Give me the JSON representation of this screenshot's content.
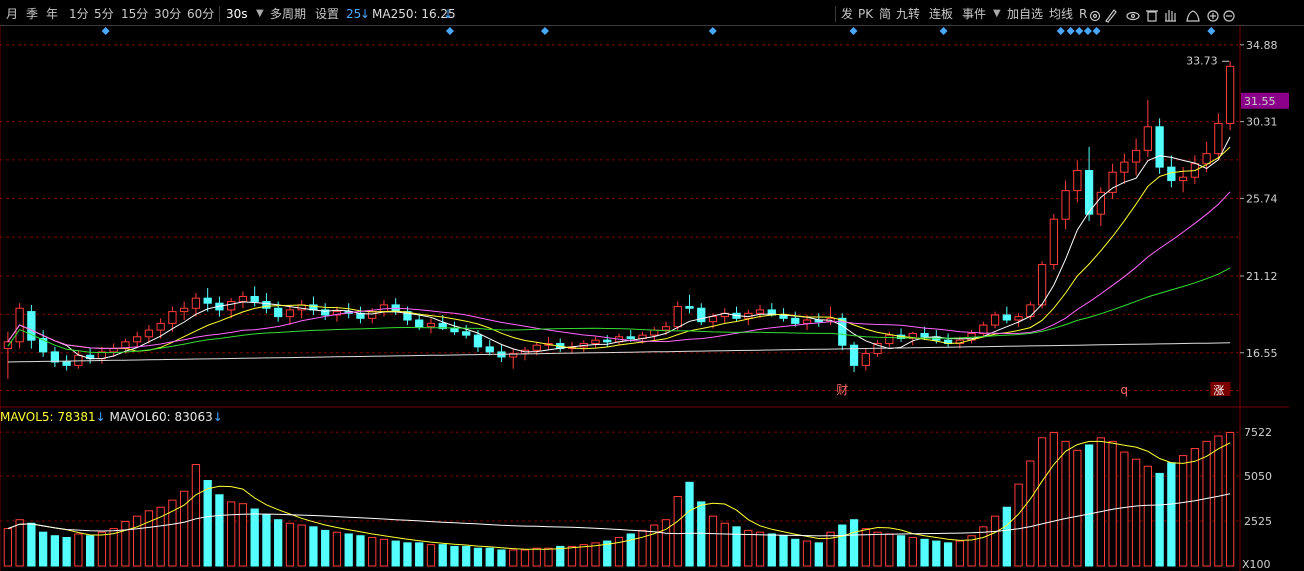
{
  "toolbar": {
    "periods": [
      "月",
      "季",
      "年",
      "1分",
      "5分",
      "15分",
      "30分",
      "60分"
    ],
    "interval": "30s",
    "multi_period": "多周期",
    "settings": "设置",
    "ma_count": "25",
    "ma250_label": "MA250: 16.25",
    "right_tools": [
      "发",
      "PK",
      "简",
      "九转",
      "连板",
      "事件"
    ],
    "add_watch": "加自选",
    "ma_lines": "均线",
    "r_mark": "R"
  },
  "price_axis": {
    "labels": [
      "34.88",
      "30.31",
      "25.74",
      "21.12",
      "16.55"
    ],
    "current_price": "31.55",
    "high_label": "33.73"
  },
  "volume_axis": {
    "labels": [
      "7522",
      "5050",
      "2525"
    ],
    "unit": "X100"
  },
  "volume_indicator": {
    "mavol5": "MAVOL5: 78381",
    "mavol60": "MAVOL60: 83063"
  },
  "markers": {
    "cai": "财",
    "q": "q",
    "zhang": "涨"
  },
  "colors": {
    "up": "#ff3c3c",
    "down": "#54ffff",
    "ma5": "#ffffff",
    "ma10": "#ffff33",
    "ma20": "#ff66ff",
    "ma60": "#33dd33",
    "ma250": "#dddddd",
    "grid": "#7a0000",
    "badge": "#8b008b"
  },
  "chart_data": {
    "type": "candlestick",
    "y_range": [
      13.5,
      36.0
    ],
    "volume_range": [
      0,
      8200
    ],
    "candles": [
      [
        16.8,
        17.8,
        15.0,
        17.2
      ],
      [
        17.2,
        19.5,
        16.8,
        19.2
      ],
      [
        19.0,
        19.4,
        16.8,
        17.3
      ],
      [
        17.4,
        17.9,
        16.3,
        16.6
      ],
      [
        16.6,
        16.9,
        15.7,
        16.0
      ],
      [
        16.0,
        16.4,
        15.5,
        15.8
      ],
      [
        15.8,
        16.7,
        15.6,
        16.4
      ],
      [
        16.4,
        16.8,
        15.9,
        16.2
      ],
      [
        16.2,
        16.9,
        15.9,
        16.6
      ],
      [
        16.6,
        17.1,
        16.3,
        16.8
      ],
      [
        16.8,
        17.4,
        16.5,
        17.2
      ],
      [
        17.2,
        17.8,
        16.9,
        17.5
      ],
      [
        17.5,
        18.2,
        17.1,
        17.9
      ],
      [
        17.9,
        18.6,
        17.4,
        18.3
      ],
      [
        18.3,
        19.3,
        17.8,
        19.0
      ],
      [
        19.0,
        19.6,
        18.5,
        19.2
      ],
      [
        19.2,
        20.1,
        18.7,
        19.8
      ],
      [
        19.8,
        20.4,
        19.0,
        19.5
      ],
      [
        19.5,
        19.9,
        18.7,
        19.1
      ],
      [
        19.1,
        19.8,
        18.6,
        19.6
      ],
      [
        19.6,
        20.2,
        19.2,
        19.9
      ],
      [
        19.9,
        20.5,
        19.3,
        19.6
      ],
      [
        19.6,
        20.1,
        18.9,
        19.2
      ],
      [
        19.2,
        19.6,
        18.4,
        18.7
      ],
      [
        18.7,
        19.4,
        18.2,
        19.1
      ],
      [
        19.1,
        19.7,
        18.6,
        19.4
      ],
      [
        19.4,
        19.9,
        18.8,
        19.1
      ],
      [
        19.1,
        19.5,
        18.5,
        18.8
      ],
      [
        18.8,
        19.3,
        18.4,
        19.0
      ],
      [
        19.0,
        19.5,
        18.6,
        18.9
      ],
      [
        18.9,
        19.3,
        18.3,
        18.6
      ],
      [
        18.6,
        19.2,
        18.3,
        19.0
      ],
      [
        19.0,
        19.7,
        18.7,
        19.4
      ],
      [
        19.4,
        19.8,
        18.8,
        19.0
      ],
      [
        19.0,
        19.3,
        18.2,
        18.5
      ],
      [
        18.5,
        18.9,
        17.9,
        18.1
      ],
      [
        18.1,
        18.6,
        17.7,
        18.3
      ],
      [
        18.3,
        18.8,
        17.9,
        18.0
      ],
      [
        18.0,
        18.4,
        17.6,
        17.8
      ],
      [
        17.8,
        18.2,
        17.4,
        17.6
      ],
      [
        17.6,
        17.9,
        16.6,
        16.9
      ],
      [
        16.9,
        17.3,
        16.4,
        16.6
      ],
      [
        16.6,
        17.0,
        16.0,
        16.3
      ],
      [
        16.3,
        16.8,
        15.6,
        16.5
      ],
      [
        16.5,
        16.9,
        16.1,
        16.7
      ],
      [
        16.7,
        17.2,
        16.4,
        17.0
      ],
      [
        17.0,
        17.5,
        16.7,
        17.1
      ],
      [
        17.1,
        17.4,
        16.6,
        16.8
      ],
      [
        16.8,
        17.2,
        16.5,
        16.9
      ],
      [
        16.9,
        17.3,
        16.6,
        17.1
      ],
      [
        17.1,
        17.5,
        16.8,
        17.3
      ],
      [
        17.3,
        17.6,
        16.9,
        17.2
      ],
      [
        17.2,
        17.7,
        17.0,
        17.5
      ],
      [
        17.5,
        17.9,
        17.2,
        17.4
      ],
      [
        17.4,
        17.8,
        17.1,
        17.6
      ],
      [
        17.6,
        18.1,
        17.3,
        17.9
      ],
      [
        17.9,
        18.4,
        17.6,
        18.1
      ],
      [
        18.1,
        19.6,
        17.9,
        19.3
      ],
      [
        19.3,
        20.0,
        18.9,
        19.2
      ],
      [
        19.2,
        19.5,
        18.2,
        18.4
      ],
      [
        18.4,
        18.9,
        18.0,
        18.7
      ],
      [
        18.7,
        19.2,
        18.3,
        18.9
      ],
      [
        18.9,
        19.3,
        18.4,
        18.6
      ],
      [
        18.6,
        19.1,
        18.2,
        18.9
      ],
      [
        18.9,
        19.4,
        18.6,
        19.1
      ],
      [
        19.1,
        19.5,
        18.7,
        18.8
      ],
      [
        18.8,
        19.2,
        18.4,
        18.6
      ],
      [
        18.6,
        19.0,
        18.1,
        18.3
      ],
      [
        18.3,
        18.8,
        17.9,
        18.5
      ],
      [
        18.5,
        18.9,
        18.1,
        18.4
      ],
      [
        18.4,
        19.3,
        18.2,
        18.6
      ],
      [
        18.6,
        18.9,
        16.7,
        17.0
      ],
      [
        17.0,
        17.2,
        15.4,
        15.8
      ],
      [
        15.8,
        16.8,
        15.5,
        16.5
      ],
      [
        16.5,
        17.3,
        16.3,
        17.1
      ],
      [
        17.1,
        17.8,
        16.9,
        17.6
      ],
      [
        17.6,
        18.0,
        17.2,
        17.4
      ],
      [
        17.4,
        17.8,
        17.0,
        17.7
      ],
      [
        17.7,
        18.1,
        17.3,
        17.5
      ],
      [
        17.5,
        17.9,
        17.1,
        17.3
      ],
      [
        17.3,
        17.7,
        16.9,
        17.1
      ],
      [
        17.1,
        17.5,
        16.8,
        17.3
      ],
      [
        17.3,
        17.9,
        17.1,
        17.7
      ],
      [
        17.7,
        18.4,
        17.5,
        18.2
      ],
      [
        18.2,
        19.0,
        18.0,
        18.8
      ],
      [
        18.8,
        19.3,
        18.3,
        18.5
      ],
      [
        18.5,
        18.9,
        18.1,
        18.7
      ],
      [
        18.7,
        19.6,
        18.5,
        19.4
      ],
      [
        19.4,
        22.0,
        19.2,
        21.8
      ],
      [
        21.8,
        24.8,
        21.5,
        24.5
      ],
      [
        24.5,
        26.8,
        23.9,
        26.2
      ],
      [
        26.2,
        28.0,
        25.5,
        27.4
      ],
      [
        27.4,
        28.8,
        24.4,
        24.8
      ],
      [
        24.8,
        26.4,
        24.1,
        26.1
      ],
      [
        26.1,
        27.8,
        25.7,
        27.3
      ],
      [
        27.3,
        28.4,
        26.6,
        27.9
      ],
      [
        27.9,
        29.3,
        27.1,
        28.6
      ],
      [
        28.6,
        31.6,
        28.2,
        30.0
      ],
      [
        30.0,
        30.5,
        27.2,
        27.6
      ],
      [
        27.6,
        28.3,
        26.4,
        26.8
      ],
      [
        26.8,
        27.6,
        26.1,
        27.0
      ],
      [
        27.0,
        28.3,
        26.6,
        27.8
      ],
      [
        27.8,
        29.1,
        27.3,
        28.4
      ],
      [
        28.4,
        30.8,
        28.0,
        30.2
      ],
      [
        30.2,
        33.9,
        29.8,
        33.6
      ]
    ],
    "volumes": [
      2100,
      2600,
      2400,
      1900,
      1700,
      1600,
      1800,
      1700,
      1900,
      2100,
      2500,
      2800,
      3100,
      3300,
      3700,
      4200,
      5700,
      4800,
      4000,
      3600,
      3500,
      3200,
      2900,
      2600,
      2400,
      2300,
      2200,
      2000,
      1900,
      1800,
      1700,
      1600,
      1500,
      1400,
      1300,
      1300,
      1200,
      1200,
      1100,
      1100,
      1000,
      1000,
      900,
      900,
      900,
      1000,
      1000,
      1100,
      1100,
      1200,
      1300,
      1400,
      1600,
      1800,
      2000,
      2300,
      2600,
      3900,
      4700,
      3600,
      2800,
      2400,
      2200,
      2000,
      1900,
      1800,
      1700,
      1500,
      1400,
      1300,
      1900,
      2300,
      2600,
      2100,
      1900,
      1800,
      1700,
      1600,
      1500,
      1400,
      1300,
      1400,
      1700,
      2200,
      2800,
      3300,
      4600,
      5900,
      7200,
      7500,
      7000,
      6500,
      6800,
      7200,
      7000,
      6400,
      6000,
      5600,
      5200,
      5800,
      6200,
      6600,
      7000,
      7300,
      7500
    ]
  }
}
